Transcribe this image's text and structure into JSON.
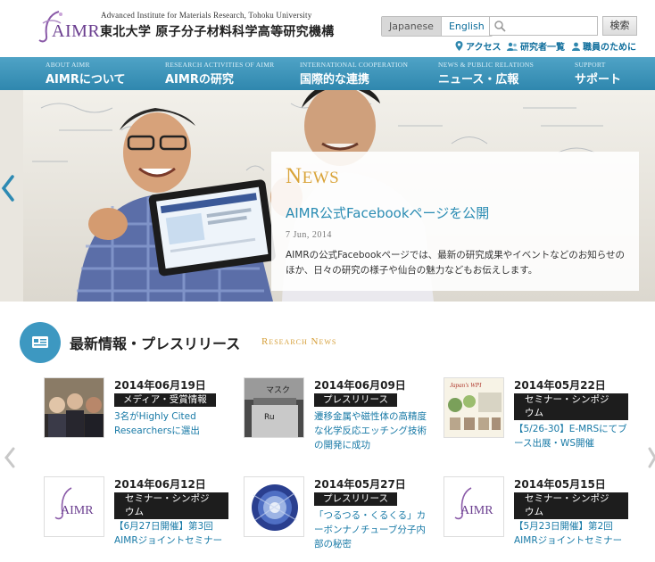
{
  "header": {
    "logo_text": "AIMR",
    "institute_en": "Advanced Institute for Materials Research, Tohoku University",
    "institute_jp": "東北大学 原子分子材料科学高等研究機構",
    "lang_japanese": "Japanese",
    "lang_english": "English",
    "search_placeholder": "",
    "search_button": "検索",
    "util_links": [
      "アクセス",
      "研究者一覧",
      "職員のために"
    ]
  },
  "nav": {
    "items": [
      {
        "en": "About AIMR",
        "jp": "AIMRについて"
      },
      {
        "en": "Research Activities of AIMR",
        "jp": "AIMRの研究"
      },
      {
        "en": "International Cooperation",
        "jp": "国際的な連携"
      },
      {
        "en": "News & Public Relations",
        "jp": "ニュース・広報"
      },
      {
        "en": "Support",
        "jp": "サポート"
      }
    ]
  },
  "hero": {
    "label_initial": "N",
    "label_rest": "EWS",
    "title": "AIMR公式Facebookページを公開",
    "date": "7 Jun, 2014",
    "body": "AIMRの公式Facebookページでは、最新の研究成果やイベントなどのお知らせのほか、日々の研究の様子や仙台の魅力などもお伝えします。"
  },
  "section": {
    "title": "最新情報・プレスリリース",
    "subtitle": "Research News"
  },
  "news_items": [
    {
      "date": "2014年06月19日",
      "category": "メディア・受賞情報",
      "text": "3名がHighly Cited Researchersに選出"
    },
    {
      "date": "2014年06月09日",
      "category": "プレスリリース",
      "text": "遷移金属や磁性体の高精度な化学反応エッチング技術の開発に成功"
    },
    {
      "date": "2014年05月22日",
      "category": "セミナー・シンポジウム",
      "text": "【5/26-30】E-MRSにてブース出展・WS開催"
    },
    {
      "date": "2014年06月12日",
      "category": "セミナー・シンポジウム",
      "text": "【6月27日開催】第3回AIMRジョイントセミナー"
    },
    {
      "date": "2014年05月27日",
      "category": "プレスリリース",
      "text": "「つるつる・くるくる」カーボンナノチューブ分子内部の秘密"
    },
    {
      "date": "2014年05月15日",
      "category": "セミナー・シンポジウム",
      "text": "【5月23日開催】第2回AIMRジョイントセミナー"
    }
  ],
  "thumb_texts": {
    "thumb2_label1": "マスク",
    "thumb2_label2": "Ru",
    "thumb3_title": "Japan's WPI",
    "logo_text": "AIMR"
  },
  "colors": {
    "nav_blue": "#3a93ba",
    "accent_gold": "#d9a43a",
    "link_blue": "#1779a6",
    "logo_purple": "#6a3d8f"
  }
}
